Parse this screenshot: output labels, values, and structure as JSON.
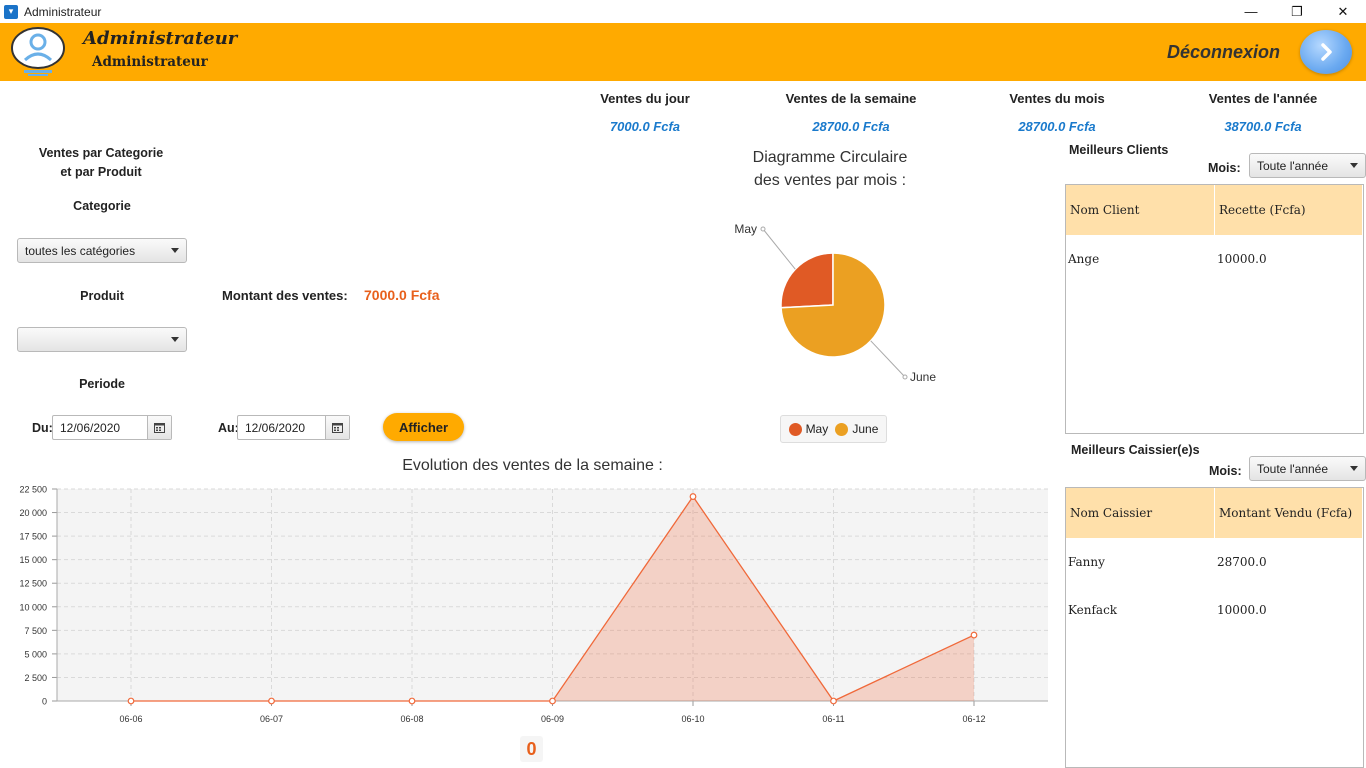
{
  "window": {
    "title": "Administrateur"
  },
  "header": {
    "user_name": "Administrateur",
    "user_role": "Administrateur",
    "logout_label": "Déconnexion"
  },
  "stats": [
    {
      "label": "Ventes du jour",
      "value": "7000.0 Fcfa"
    },
    {
      "label": "Ventes de la semaine",
      "value": "28700.0 Fcfa"
    },
    {
      "label": "Ventes du mois",
      "value": "28700.0 Fcfa"
    },
    {
      "label": "Ventes de l'année",
      "value": "38700.0 Fcfa"
    }
  ],
  "filters": {
    "section_title_1": "Ventes par Categorie",
    "section_title_2": "et par Produit",
    "categorie_label": "Categorie",
    "categorie_value": "toutes les catégories",
    "produit_label": "Produit",
    "produit_value": "",
    "periode_label": "Periode",
    "du_label": "Du:",
    "du_value": "12/06/2020",
    "au_label": "Au:",
    "au_value": "12/06/2020",
    "afficher_label": "Afficher",
    "montant_label": "Montant des ventes:",
    "montant_value": "7000.0 Fcfa"
  },
  "pie": {
    "title_1": "Diagramme Circulaire",
    "title_2": "des ventes par mois :",
    "slices": [
      {
        "name": "May",
        "value": 10000,
        "color": "#e05a25"
      },
      {
        "name": "June",
        "value": 28700,
        "color": "#eba022"
      }
    ]
  },
  "best_clients": {
    "title": "Meilleurs Clients",
    "mois_label": "Mois:",
    "mois_value": "Toute l'année",
    "columns": [
      "Nom Client",
      "Recette (Fcfa)"
    ],
    "rows": [
      [
        "Ange",
        "10000.0"
      ]
    ]
  },
  "best_cashiers": {
    "title": "Meilleurs Caissier(e)s",
    "mois_label": "Mois:",
    "mois_value": "Toute l'année",
    "columns": [
      "Nom Caissier",
      "Montant Vendu (Fcfa)"
    ],
    "rows": [
      [
        "Fanny",
        "28700.0"
      ],
      [
        "Kenfack",
        "10000.0"
      ]
    ]
  },
  "chart_data": {
    "type": "area",
    "title": "Evolution des ventes de la semaine :",
    "categories": [
      "06-06",
      "06-07",
      "06-08",
      "06-09",
      "06-10",
      "06-11",
      "06-12"
    ],
    "values": [
      0,
      0,
      0,
      0,
      21700,
      0,
      7000
    ],
    "ylim": [
      0,
      22500
    ],
    "yticks": [
      "0",
      "2 500",
      "5 000",
      "7 500",
      "10 000",
      "12 500",
      "15 000",
      "17 500",
      "20 000",
      "22 500"
    ],
    "color": "#f0693a",
    "grid": true
  },
  "footer_counter": "0"
}
